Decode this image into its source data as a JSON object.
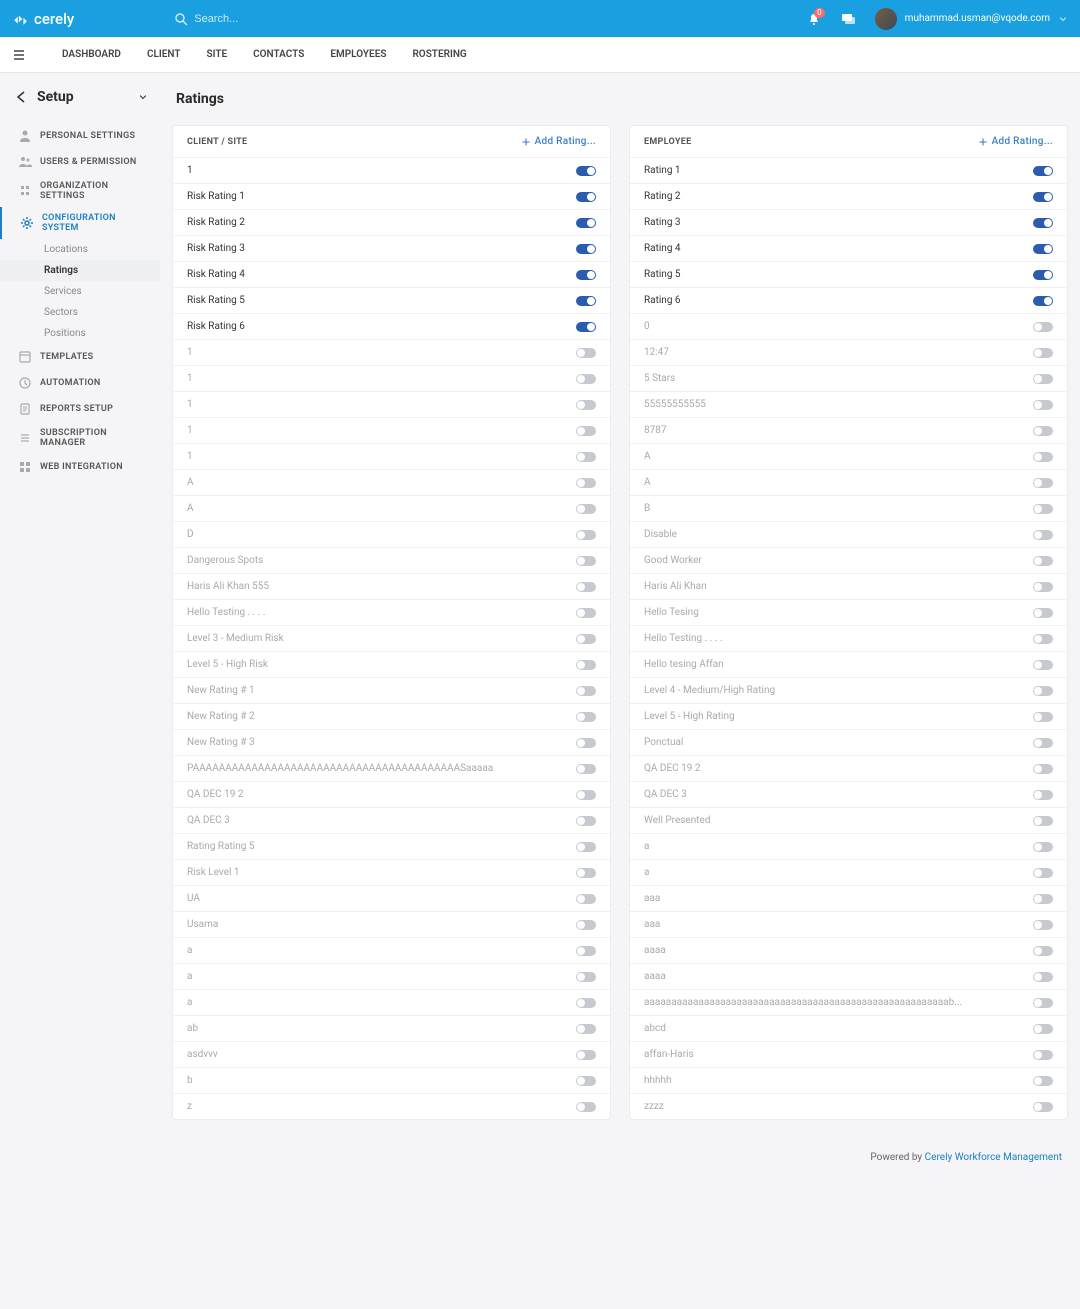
{
  "header": {
    "brand": "cerely",
    "search_placeholder": "Search...",
    "notif_count": "0",
    "user_email": "muhammad.usman@vqode.com"
  },
  "nav": {
    "items": [
      "DASHBOARD",
      "CLIENT",
      "SITE",
      "CONTACTS",
      "EMPLOYEES",
      "ROSTERING"
    ]
  },
  "sidebar": {
    "title": "Setup",
    "items": [
      {
        "label": "PERSONAL SETTINGS",
        "icon": "user"
      },
      {
        "label": "USERS & PERMISSION",
        "icon": "users"
      },
      {
        "label": "ORGANIZATION SETTINGS",
        "icon": "org"
      },
      {
        "label": "CONFIGURATION SYSTEM",
        "icon": "gear",
        "active": true,
        "subs": [
          {
            "label": "Locations"
          },
          {
            "label": "Ratings",
            "active": true
          },
          {
            "label": "Services"
          },
          {
            "label": "Sectors"
          },
          {
            "label": "Positions"
          }
        ]
      },
      {
        "label": "TEMPLATES",
        "icon": "template"
      },
      {
        "label": "AUTOMATION",
        "icon": "auto"
      },
      {
        "label": "REPORTS SETUP",
        "icon": "report"
      },
      {
        "label": "SUBSCRIPTION MANAGER",
        "icon": "sub"
      },
      {
        "label": "WEB INTEGRATION",
        "icon": "web"
      }
    ]
  },
  "content": {
    "title": "Ratings",
    "panels": [
      {
        "title": "CLIENT / SITE",
        "add_label": "Add Rating...",
        "rows": [
          {
            "label": "1",
            "on": true
          },
          {
            "label": "Risk Rating 1",
            "on": true
          },
          {
            "label": "Risk Rating 2",
            "on": true
          },
          {
            "label": "Risk Rating 3",
            "on": true
          },
          {
            "label": "Risk Rating 4",
            "on": true
          },
          {
            "label": "Risk Rating 5",
            "on": true
          },
          {
            "label": "Risk Rating 6",
            "on": true
          },
          {
            "label": "1",
            "on": false
          },
          {
            "label": "1",
            "on": false
          },
          {
            "label": "1",
            "on": false
          },
          {
            "label": "1",
            "on": false
          },
          {
            "label": "1",
            "on": false
          },
          {
            "label": "A",
            "on": false
          },
          {
            "label": "A",
            "on": false
          },
          {
            "label": "D",
            "on": false
          },
          {
            "label": "Dangerous Spots",
            "on": false
          },
          {
            "label": "Haris Ali Khan 555",
            "on": false
          },
          {
            "label": "Hello Testing . . . .",
            "on": false
          },
          {
            "label": "Level 3 - Medium Risk",
            "on": false
          },
          {
            "label": "Level 5 - High Risk",
            "on": false
          },
          {
            "label": "New Rating # 1",
            "on": false
          },
          {
            "label": "New Rating # 2",
            "on": false
          },
          {
            "label": "New Rating # 3",
            "on": false
          },
          {
            "label": "PAAAAAAAAAAAAAAAAAAAAAAAAAAAAAAAAAAAAAAAAASaaaaa",
            "on": false
          },
          {
            "label": "QA DEC 19 2",
            "on": false
          },
          {
            "label": "QA DEC 3",
            "on": false
          },
          {
            "label": "Rating Rating 5",
            "on": false
          },
          {
            "label": "Risk Level 1",
            "on": false
          },
          {
            "label": "UA",
            "on": false
          },
          {
            "label": "Usama",
            "on": false
          },
          {
            "label": "a",
            "on": false
          },
          {
            "label": "a",
            "on": false
          },
          {
            "label": "a",
            "on": false
          },
          {
            "label": "ab",
            "on": false
          },
          {
            "label": "asdvvv",
            "on": false
          },
          {
            "label": "b",
            "on": false
          },
          {
            "label": "z",
            "on": false
          }
        ]
      },
      {
        "title": "EMPLOYEE",
        "add_label": "Add Rating...",
        "rows": [
          {
            "label": "Rating 1",
            "on": true
          },
          {
            "label": "Rating 2",
            "on": true
          },
          {
            "label": "Rating 3",
            "on": true
          },
          {
            "label": "Rating 4",
            "on": true
          },
          {
            "label": "Rating 5",
            "on": true
          },
          {
            "label": "Rating 6",
            "on": true
          },
          {
            "label": "0",
            "on": false
          },
          {
            "label": "12:47",
            "on": false
          },
          {
            "label": "5 Stars",
            "on": false
          },
          {
            "label": "55555555555",
            "on": false
          },
          {
            "label": "8787",
            "on": false
          },
          {
            "label": "A",
            "on": false
          },
          {
            "label": "A",
            "on": false
          },
          {
            "label": "B",
            "on": false
          },
          {
            "label": "Disable",
            "on": false
          },
          {
            "label": "Good Worker",
            "on": false
          },
          {
            "label": "Haris Ali Khan",
            "on": false
          },
          {
            "label": "Hello Tesing",
            "on": false
          },
          {
            "label": "Hello Testing . . . .",
            "on": false
          },
          {
            "label": "Hello tesing Affan",
            "on": false
          },
          {
            "label": "Level 4 - Medium/High Rating",
            "on": false
          },
          {
            "label": "Level 5 - High Rating",
            "on": false
          },
          {
            "label": "Ponctual",
            "on": false
          },
          {
            "label": "QA DEC 19 2",
            "on": false
          },
          {
            "label": "QA DEC 3",
            "on": false
          },
          {
            "label": "Well Presented",
            "on": false
          },
          {
            "label": "a",
            "on": false
          },
          {
            "label": "a",
            "on": false
          },
          {
            "label": "aaa",
            "on": false
          },
          {
            "label": "aaa",
            "on": false
          },
          {
            "label": "aaaa",
            "on": false
          },
          {
            "label": "aaaa",
            "on": false
          },
          {
            "label": "aaaaaaaaaaaaaaaaaaaaaaaaaaaaaaaaaaaaaaaaaaaaaaaaaaaaaaaab...",
            "on": false
          },
          {
            "label": "abcd",
            "on": false
          },
          {
            "label": "affan-Haris",
            "on": false
          },
          {
            "label": "hhhhh",
            "on": false
          },
          {
            "label": "zzzz",
            "on": false
          }
        ]
      }
    ]
  },
  "footer": {
    "prefix": "Powered by ",
    "link": "Cerely Workforce Management"
  }
}
